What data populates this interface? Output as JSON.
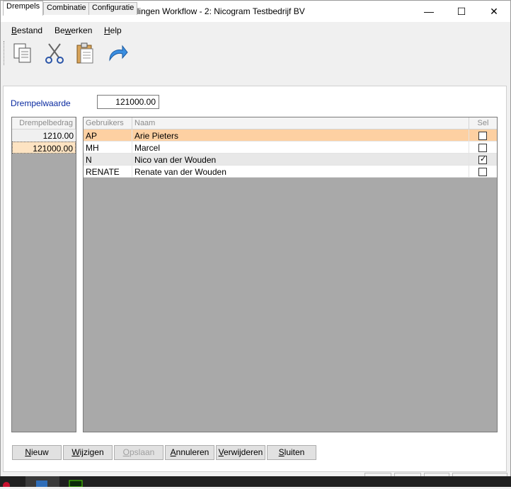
{
  "window": {
    "title": "KOMAS - 4160 Beheren instellingen Workflow - 2: Nicogram Testbedrijf BV",
    "controls": {
      "minimize": "—",
      "maximize": "☐",
      "close": "✕"
    }
  },
  "menu": {
    "items": [
      {
        "pre": "",
        "ul": "B",
        "post": "estand"
      },
      {
        "pre": "Be",
        "ul": "w",
        "post": "erken"
      },
      {
        "pre": "",
        "ul": "H",
        "post": "elp"
      }
    ]
  },
  "toolbar": {
    "buttons": [
      "copy-icon",
      "cut-icon",
      "paste-icon",
      "undo-icon"
    ]
  },
  "tabs": [
    "Drempels",
    "Combinatie",
    "Configuratie"
  ],
  "drempel": {
    "label": "Drempelwaarde",
    "value": "121000.00"
  },
  "left_grid": {
    "header": "Drempelbedrag",
    "rows": [
      "1210.00",
      "121000.00"
    ]
  },
  "right_grid": {
    "headers": {
      "code": "Gebruikers",
      "name": "Naam",
      "sel": "Sel"
    },
    "rows": [
      {
        "code": "AP",
        "name": "Arie Pieters",
        "sel": false
      },
      {
        "code": "MH",
        "name": "Marcel",
        "sel": false
      },
      {
        "code": "N",
        "name": "Nico van der Wouden",
        "sel": true
      },
      {
        "code": "RENATE",
        "name": "Renate van der Wouden",
        "sel": false
      }
    ]
  },
  "buttons": [
    {
      "pre": "",
      "ul": "N",
      "post": "ieuw",
      "disabled": false
    },
    {
      "pre": "",
      "ul": "W",
      "post": "ijzigen",
      "disabled": false
    },
    {
      "pre": "",
      "ul": "O",
      "post": "pslaan",
      "disabled": true
    },
    {
      "pre": "",
      "ul": "A",
      "post": "nnuleren",
      "disabled": false
    },
    {
      "pre": "",
      "ul": "V",
      "post": "erwijderen",
      "disabled": false
    },
    {
      "pre": "",
      "ul": "S",
      "post": "luiten",
      "disabled": false
    }
  ],
  "colors": {
    "selected_row": "#fdd0a2",
    "grid_background": "#a9a9a9",
    "label_blue": "#0a2aa0"
  }
}
